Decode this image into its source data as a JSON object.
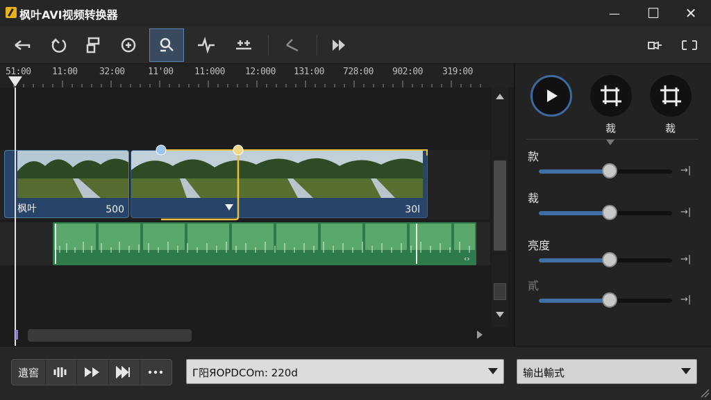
{
  "app": {
    "title": "枫叶AVI视频转换器"
  },
  "window_controls": {
    "minimize": "—",
    "maximize": "☐",
    "close": "✕"
  },
  "toolbar": {
    "icons": [
      "undo-icon",
      "rotate-icon",
      "split-icon",
      "add-marker-icon",
      "magic-search-icon",
      "audio-split-icon",
      "add-track-icon",
      "back-icon",
      "forward-icon",
      "snapshot-icon",
      "crop-icon"
    ],
    "active_index": 4
  },
  "ruler": {
    "labels": [
      "51:00",
      "11:00",
      "32:00",
      "11'00",
      "11:000",
      "12:000",
      "131:00",
      "728:00",
      "902:00",
      "319:00"
    ]
  },
  "timeline": {
    "clip1": {
      "label": "枫叶",
      "duration": "500"
    },
    "clip2": {
      "duration": "30l"
    }
  },
  "panel": {
    "play_label": "",
    "crop1_label": "裁",
    "crop2_label": "裁",
    "sliders": [
      {
        "label": "款",
        "value": 0.53
      },
      {
        "label": "裁",
        "value": 0.53
      },
      {
        "label": "亮度",
        "value": 0.53
      },
      {
        "label": "貳",
        "value": 0.53
      }
    ]
  },
  "bottom": {
    "transport_first": "遺窖",
    "format_value": "Г阳ЯОРDCОm: 220d",
    "output_value": "输出輸式"
  },
  "colors": {
    "accent": "#3f6ea8",
    "clip": "#284468",
    "audio": "#2f7a4a",
    "selection": "#e8c040"
  }
}
